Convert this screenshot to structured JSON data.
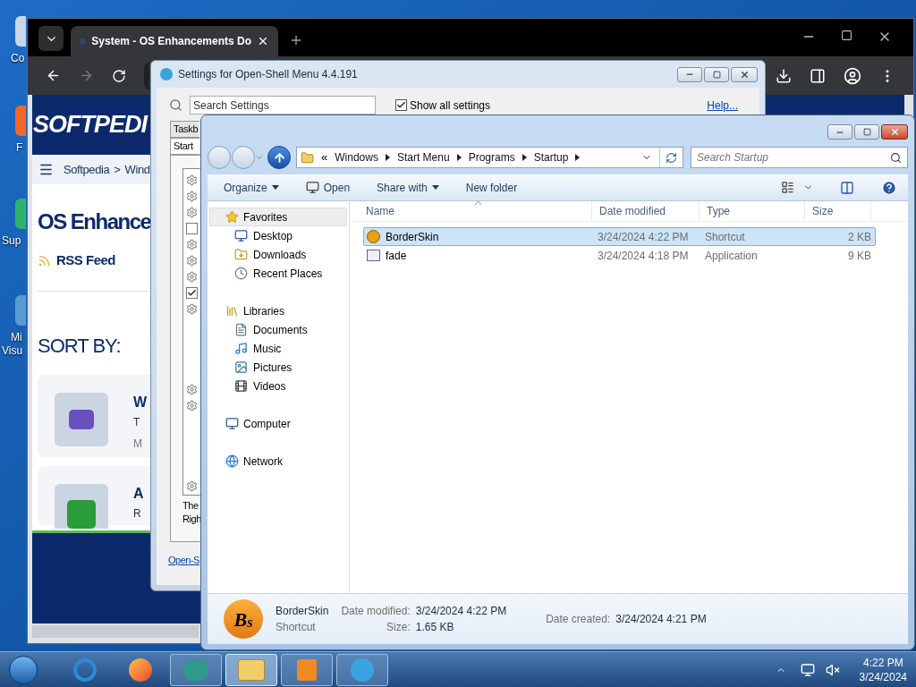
{
  "desktop_icons": [
    {
      "kind": "computer",
      "lines": [
        "Co"
      ]
    },
    {
      "kind": "firefox",
      "lines": [
        "F"
      ]
    },
    {
      "kind": "support",
      "lines": [
        "Sup"
      ]
    },
    {
      "kind": "studio",
      "lines": [
        "Mi",
        "Visu"
      ]
    }
  ],
  "browser": {
    "tab_title": "System - OS Enhancements Do",
    "site": {
      "logo": "SOFTPEDI",
      "breadcrumb": [
        "Softpedia",
        ">",
        "Wind"
      ],
      "heading": "OS Enhance",
      "rss": "RSS Feed",
      "sort_label": "SORT BY:",
      "cards": [
        {
          "kind": "robot",
          "title": "W",
          "line_1": "T",
          "line_2": "M"
        },
        {
          "kind": "h-app",
          "title": "A",
          "line_1": "R"
        }
      ]
    }
  },
  "settings": {
    "title": "Settings for Open-Shell Menu 4.4.191",
    "search_placeholder": "Search Settings",
    "show_all": {
      "label": "Show all settings",
      "checked": true
    },
    "help_link": "Help...",
    "tabs": [
      {
        "label": "Taskb",
        "selected": false
      },
      {
        "label": "Start",
        "selected": true
      }
    ],
    "options": [
      {
        "kind": "gear"
      },
      {
        "kind": "gear"
      },
      {
        "kind": "gear"
      },
      {
        "kind": "checkbox",
        "checked": false
      },
      {
        "kind": "gear"
      },
      {
        "kind": "gear"
      },
      {
        "kind": "gear"
      },
      {
        "kind": "checkbox",
        "checked": true
      },
      {
        "kind": "gear"
      },
      {
        "kind": "blank"
      },
      {
        "kind": "blank"
      },
      {
        "kind": "blank"
      },
      {
        "kind": "blank"
      },
      {
        "kind": "gear"
      },
      {
        "kind": "gear"
      },
      {
        "kind": "blank"
      },
      {
        "kind": "blank"
      },
      {
        "kind": "blank"
      },
      {
        "kind": "blank"
      },
      {
        "kind": "gear"
      }
    ],
    "description_lines": [
      "The",
      "Righ"
    ],
    "footer_link": "Open-S"
  },
  "explorer": {
    "overflow_mark": "«",
    "breadcrumb": [
      "Windows",
      "Start Menu",
      "Programs",
      "Startup"
    ],
    "search_placeholder": "Search Startup",
    "toolbar": [
      {
        "label": "Organize",
        "kind": "menu"
      },
      {
        "label": "Open",
        "kind": "icon"
      },
      {
        "label": "Share with",
        "kind": "menu"
      },
      {
        "label": "New folder",
        "kind": "plain"
      }
    ],
    "nav": [
      {
        "label": "Favorites",
        "kind": "star",
        "selected": true,
        "children": [
          {
            "label": "Desktop",
            "kind": "desktop"
          },
          {
            "label": "Downloads",
            "kind": "downloads"
          },
          {
            "label": "Recent Places",
            "kind": "recent"
          }
        ]
      },
      {
        "label": "Libraries",
        "kind": "libraries",
        "selected": false,
        "children": [
          {
            "label": "Documents",
            "kind": "documents"
          },
          {
            "label": "Music",
            "kind": "music"
          },
          {
            "label": "Pictures",
            "kind": "pictures"
          },
          {
            "label": "Videos",
            "kind": "videos"
          }
        ]
      },
      {
        "label": "Computer",
        "kind": "computer",
        "selected": false
      },
      {
        "label": "Network",
        "kind": "network",
        "selected": false
      }
    ],
    "columns": [
      {
        "label": "Name",
        "sorted": true
      },
      {
        "label": "Date modified",
        "sorted": false
      },
      {
        "label": "Type",
        "sorted": false
      },
      {
        "label": "Size",
        "sorted": false
      }
    ],
    "files": [
      {
        "name": "BorderSkin",
        "date": "3/24/2024 4:22 PM",
        "type": "Shortcut",
        "size": "2 KB",
        "kind": "shortcut",
        "selected": true
      },
      {
        "name": "fade",
        "date": "3/24/2024 4:18 PM",
        "type": "Application",
        "size": "9 KB",
        "kind": "application",
        "selected": false
      }
    ],
    "details": {
      "logo": "B$_{s}$",
      "name": "BorderSkin",
      "type": "Shortcut",
      "fields": [
        {
          "label": "Date modified:",
          "value": "3/24/2024 4:22 PM"
        },
        {
          "label": "Size:",
          "value": "1.65 KB"
        },
        {
          "label": "Date created:",
          "value": "3/24/2024 4:21 PM"
        }
      ]
    }
  },
  "taskbar": {
    "apps": [
      {
        "kind": "ie",
        "open": false,
        "active": false
      },
      {
        "kind": "firefox",
        "open": false,
        "active": false
      },
      {
        "kind": "bubble",
        "open": true,
        "active": false
      },
      {
        "kind": "explorer",
        "open": true,
        "active": true
      },
      {
        "kind": "media",
        "open": true,
        "active": false
      },
      {
        "kind": "openshell",
        "open": true,
        "active": false
      }
    ],
    "time": "4:22 PM",
    "date": "3/24/2024"
  }
}
